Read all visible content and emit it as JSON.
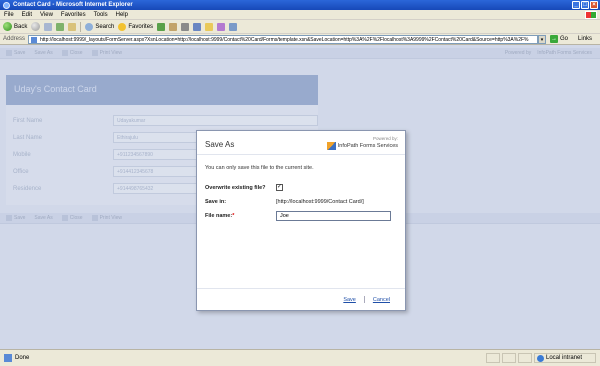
{
  "window": {
    "title": "Contact Card - Microsoft Internet Explorer"
  },
  "menu": [
    "File",
    "Edit",
    "View",
    "Favorites",
    "Tools",
    "Help"
  ],
  "toolbar": {
    "back_label": "Back",
    "search_label": "Search",
    "favorites_label": "Favorites"
  },
  "address": {
    "label": "Address",
    "url": "http://localhost:9999/_layouts/FormServer.aspx?XsnLocation=http://localhost:9999/Contact%20Card/Forms/template.xsn&SaveLocation=http%3A%2F%2Flocalhost%3A9999%2FContact%20Card&Source=http%3A%2F%",
    "go_label": "Go",
    "links_label": "Links"
  },
  "ip_toolbar": {
    "save_label": "Save",
    "save_as_label": "Save As",
    "close_label": "Close",
    "print_view_label": "Print View",
    "brand_left": "Powered by",
    "brand_right": "InfoPath Forms Services"
  },
  "form": {
    "title": "Uday's Contact Card",
    "fields": [
      {
        "label": "First Name",
        "value": "Udayakumar"
      },
      {
        "label": "Last Name",
        "value": "Ethirajulu"
      },
      {
        "label": "Mobile",
        "value": "+911234567890"
      },
      {
        "label": "Office",
        "value": "+914412345678"
      },
      {
        "label": "Residence",
        "value": "+914498765432"
      }
    ]
  },
  "dialog": {
    "title": "Save As",
    "powered_by": "Powered by:",
    "brand": "InfoPath Forms Services",
    "message": "You can only save this file to the current site.",
    "overwrite_label": "Overwrite existing file?",
    "overwrite_checked": true,
    "save_in_label": "Save in:",
    "save_in_value": "[http://localhost:9999/Contact Card/]",
    "filename_label": "File name:",
    "required_mark": "*",
    "filename_value": "Joe",
    "save_label": "Save",
    "cancel_label": "Cancel"
  },
  "status": {
    "text": "Done",
    "zone": "Local intranet"
  }
}
